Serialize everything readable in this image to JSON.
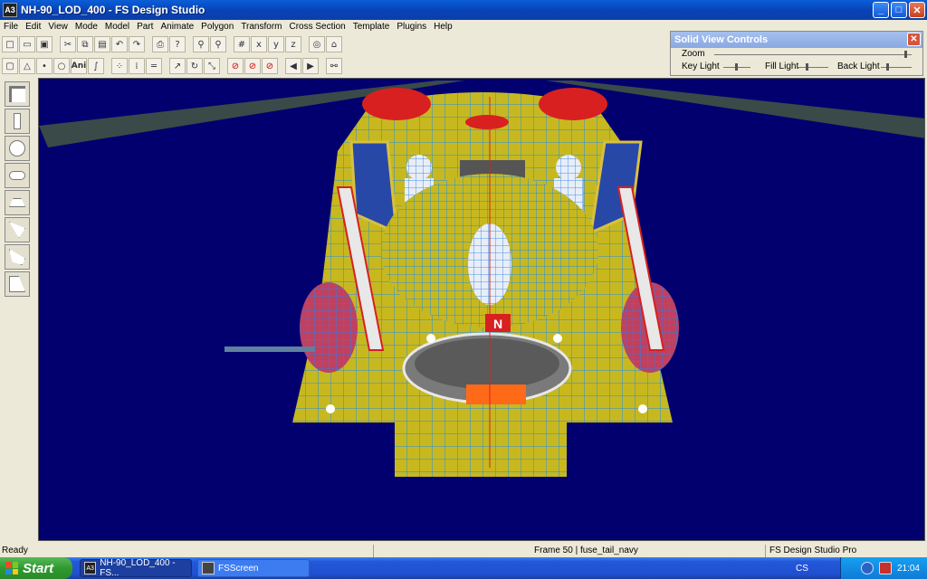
{
  "window": {
    "title": "NH-90_LOD_400 - FS Design Studio",
    "app_icon": "A3"
  },
  "menu": [
    "File",
    "Edit",
    "View",
    "Mode",
    "Model",
    "Part",
    "Animate",
    "Polygon",
    "Transform",
    "Cross Section",
    "Template",
    "Plugins",
    "Help"
  ],
  "solid_view_controls": {
    "title": "Solid View Controls",
    "zoom_label": "Zoom",
    "key_light_label": "Key Light",
    "fill_light_label": "Fill Light",
    "back_light_label": "Back Light",
    "zoom_level": 0.97,
    "key_light_level": 0.45,
    "fill_light_level": 0.3,
    "back_light_level": 0.2
  },
  "toolbar2": {
    "ani_label": "Ani"
  },
  "status": {
    "left": "Ready",
    "frame": "Frame 50 | fuse_tail_navy",
    "app": "FS Design Studio Pro"
  },
  "taskbar": {
    "start_label": "Start",
    "task1": "NH-90_LOD_400 - FS...",
    "task2": "FSScreen",
    "lang": "CS",
    "clock": "21:04"
  },
  "model": {
    "nose_letter": "N"
  },
  "colors": {
    "viewport_bg": "#02006e",
    "fuselage": "#c8b820",
    "wire": "#1e90e8",
    "accent_red": "#d82020"
  }
}
